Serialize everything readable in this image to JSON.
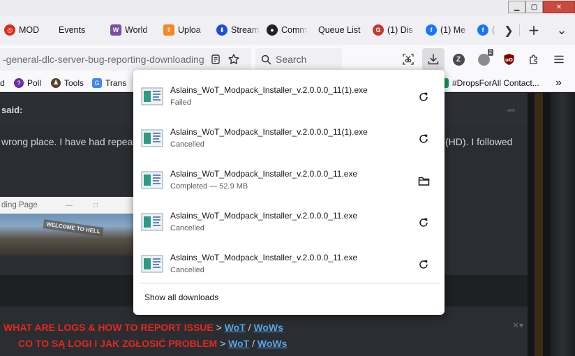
{
  "window": {
    "minimize_glyph": "▁",
    "maximize_glyph": "▢",
    "close_glyph": "✕"
  },
  "tabs": [
    {
      "label": "MOD",
      "icon": "target-icon",
      "color": "#d92d20"
    },
    {
      "label": "Events",
      "icon": "",
      "color": ""
    },
    {
      "label": "World",
      "icon": "tanks-icon",
      "color": "#7a4fa0"
    },
    {
      "label": "Uploa",
      "icon": "upload-icon",
      "color": "#f08a24"
    },
    {
      "label": "Stream",
      "icon": "stream-icon",
      "color": "#1b4fd8"
    },
    {
      "label": "Comm",
      "icon": "community-icon",
      "color": "#222222"
    },
    {
      "label": "Queue List",
      "icon": "",
      "color": ""
    },
    {
      "label": "(1) Dis",
      "icon": "discord-icon",
      "color": "#c0392b"
    },
    {
      "label": "(1) Me",
      "icon": "facebook-icon",
      "color": "#1877f2"
    },
    {
      "label": "(",
      "icon": "facebook-icon",
      "color": "#1877f2"
    }
  ],
  "tabstrip": {
    "scroll_glyph": "❯",
    "new_tab_glyph": "+",
    "list_glyph": "⌄"
  },
  "navbar": {
    "url": "-general-dlc-server-bug-reporting-downloading",
    "search_placeholder": "Search",
    "extension_badge": "2"
  },
  "bookmarks": [
    {
      "label": "d",
      "icon": ""
    },
    {
      "label": "Poll",
      "icon": "poll-icon"
    },
    {
      "label": "Tools",
      "icon": "tools-icon"
    },
    {
      "label": "Trans",
      "icon": "translate-icon"
    },
    {
      "label": "#DropsForAll Contact...",
      "icon": "sheets-icon"
    }
  ],
  "bookmarks_overflow_glyph": "»",
  "downloads": {
    "items": [
      {
        "filename": "Aslains_WoT_Modpack_Installer_v.2.0.0.0_11(1).exe",
        "status": "Failed",
        "action": "retry"
      },
      {
        "filename": "Aslains_WoT_Modpack_Installer_v.2.0.0.0_11(1).exe",
        "status": "Cancelled",
        "action": "retry"
      },
      {
        "filename": "Aslains_WoT_Modpack_Installer_v.2.0.0.0_11.exe",
        "status": "Completed — 52.9 MB",
        "action": "open-folder"
      },
      {
        "filename": "Aslains_WoT_Modpack_Installer_v.2.0.0.0_11.exe",
        "status": "Cancelled",
        "action": "retry"
      },
      {
        "filename": "Aslains_WoT_Modpack_Installer_v.2.0.0.0_11.exe",
        "status": "Cancelled",
        "action": "retry"
      }
    ],
    "show_all_label": "Show all downloads"
  },
  "page": {
    "said_label": "said:",
    "post_text_left": "wrong place.  I have had repeate",
    "post_text_right": "(HD).  I followed",
    "embed_title": "ding Page",
    "embed_image_text": "WELCOME TO HELL",
    "signature": {
      "line1_red": "WHAT ARE LOGS & HOW TO REPORT ISSUE",
      "line2_red": "CO TO SĄ LOGI I JAK ZGŁOSIĆ PROBLEM",
      "sep_gt": ">",
      "sep_slash": "/",
      "link_wot": "WoT",
      "link_wows": "WoWs"
    },
    "close_glyph": "✕▾"
  }
}
